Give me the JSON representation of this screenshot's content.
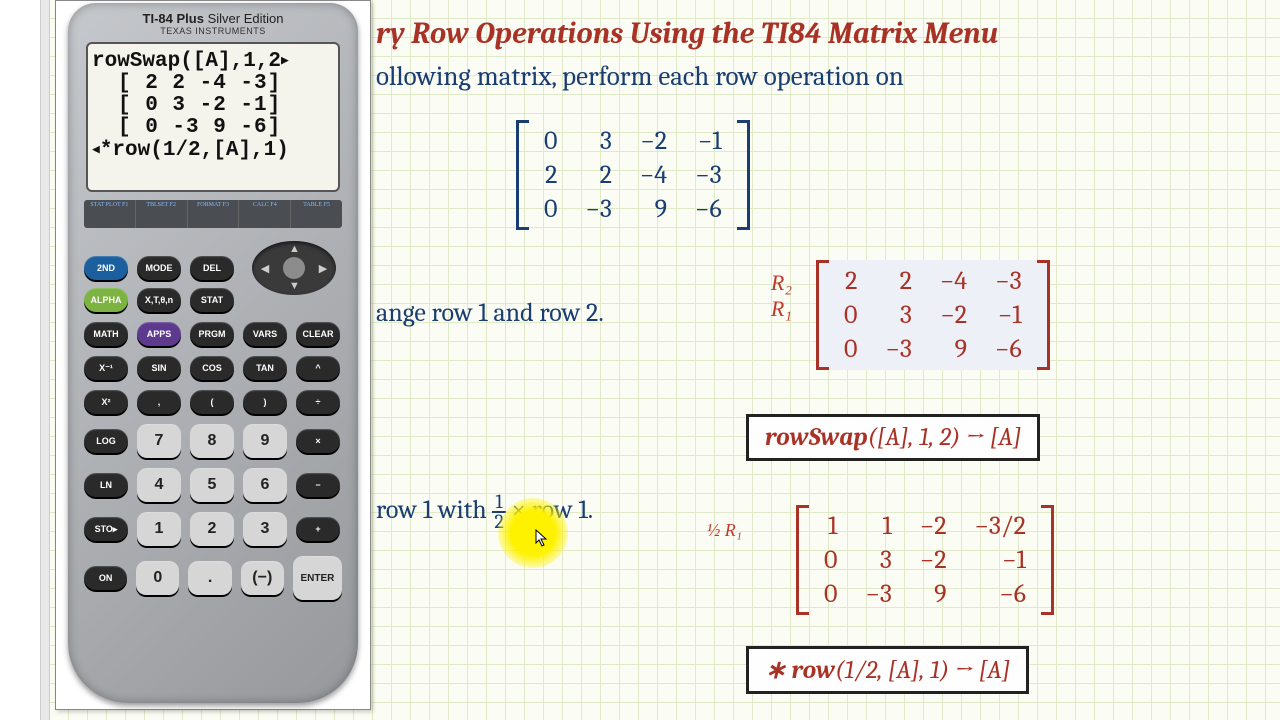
{
  "calc": {
    "model_bold": "TI-84 Plus",
    "model_light": " Silver Edition",
    "brand": "TEXAS INSTRUMENTS",
    "screen_l1": "rowSwap([A],1,2",
    "screen_r1": "[ 2  2  -4  -3]",
    "screen_r2": "[ 0  3  -2  -1]",
    "screen_r3": "[ 0 -3   9  -6]",
    "screen_l2": "*row(1/2,[A],1)",
    "tri_r": "▶",
    "tri_l": "◀",
    "fk": [
      "STAT PLOT F1",
      "TBLSET F2",
      "FORMAT F3",
      "CALC F4",
      "TABLE F5"
    ]
  },
  "title": "ry Row Operations Using the TI84 Matrix Menu",
  "lead": "ollowing matrix, perform each row operation on",
  "matrix_main": [
    [
      "0",
      "3",
      "−2",
      "−1"
    ],
    [
      "2",
      "2",
      "−4",
      "−3"
    ],
    [
      "0",
      "−3",
      "9",
      "−6"
    ]
  ],
  "op_a": "ange row 1 and row 2.",
  "labels_a": [
    "R₂",
    "R₁"
  ],
  "matrix_a": [
    [
      "2",
      "2",
      "−4",
      "−3"
    ],
    [
      "0",
      "3",
      "−2",
      "−1"
    ],
    [
      "0",
      "−3",
      "9",
      "−6"
    ]
  ],
  "code_a_pre": "rowSwap",
  "code_a_args": "([A], 1, 2) → [A]",
  "op_b_pre": " row 1 with ",
  "op_b_frac_n": "1",
  "op_b_frac_d": "2",
  "op_b_post": " × row 1.",
  "label_b": "½ R₁",
  "matrix_b": [
    [
      "1",
      "1",
      "−2",
      "−3/2"
    ],
    [
      "0",
      "3",
      "−2",
      "−1"
    ],
    [
      "0",
      "−3",
      "9",
      "−6"
    ]
  ],
  "code_b_pre": "∗ row",
  "code_b_args": "(1/2, [A], 1) → [A]",
  "keys": {
    "r1": [
      "2ND",
      "MODE",
      "DEL"
    ],
    "r2": [
      "ALPHA",
      "X,T,θ,n",
      "STAT"
    ],
    "r3": [
      "MATH",
      "APPS",
      "PRGM",
      "VARS",
      "CLEAR"
    ],
    "r4": [
      "X⁻¹",
      "SIN",
      "COS",
      "TAN",
      "^"
    ],
    "r5": [
      "X²",
      ",",
      "(",
      ")",
      "÷"
    ],
    "r6": [
      "LOG",
      "7",
      "8",
      "9",
      "×"
    ],
    "r7": [
      "LN",
      "4",
      "5",
      "6",
      "−"
    ],
    "r8": [
      "STO▸",
      "1",
      "2",
      "3",
      "+"
    ],
    "r9": [
      "ON",
      "0",
      ".",
      "(−)",
      "ENTER"
    ]
  }
}
